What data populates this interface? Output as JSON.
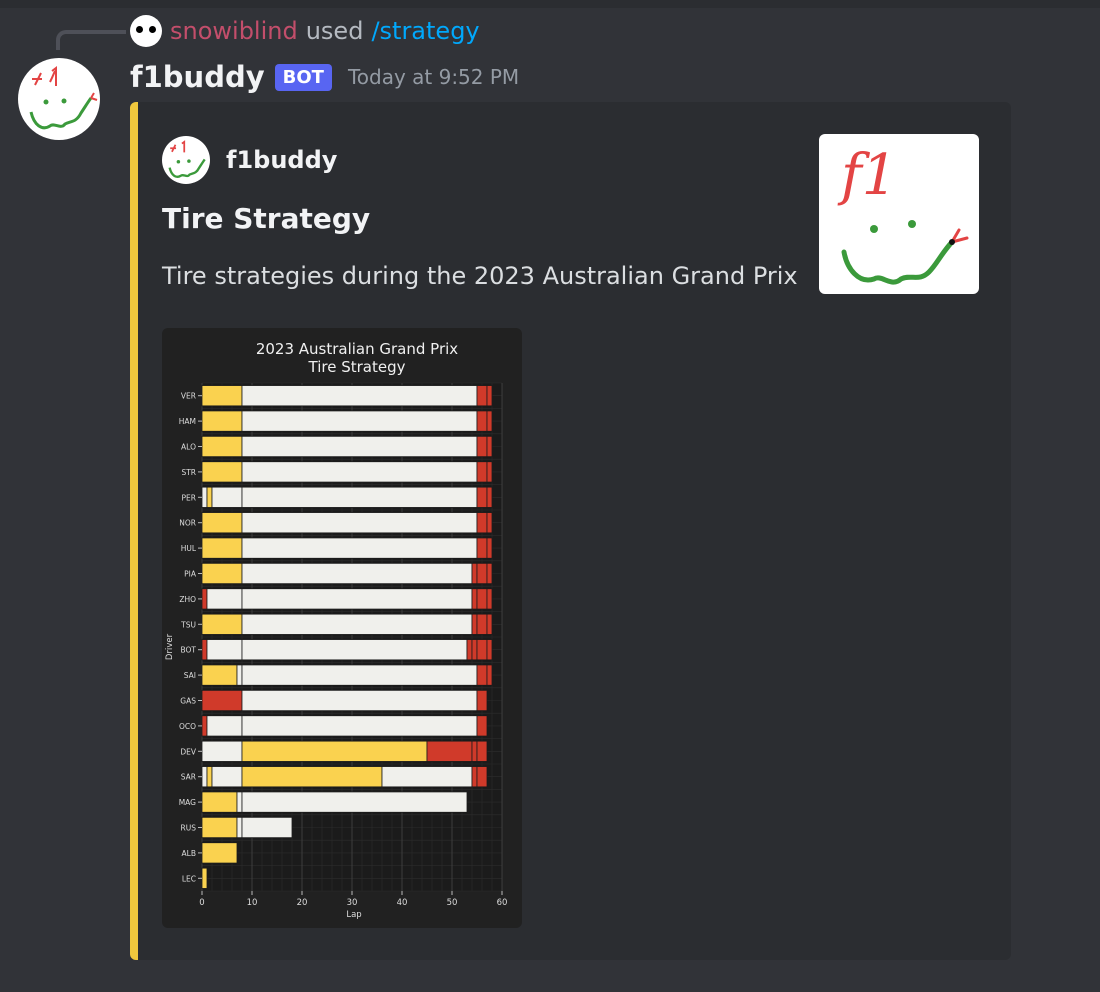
{
  "reply": {
    "user": "snowiblind",
    "used": "used",
    "command": "/strategy"
  },
  "message": {
    "author": "f1buddy",
    "tag": "BOT",
    "timestamp": "Today at 9:52 PM"
  },
  "embed": {
    "author_name": "f1buddy",
    "title": "Tire Strategy",
    "description": "Tire strategies during the 2023 Australian Grand Prix",
    "accent_color": "#f0c83d",
    "thumbnail_text": "f1"
  },
  "chart_data": {
    "type": "bar",
    "orientation": "horizontal-stacked",
    "title": "2023 Australian Grand Prix",
    "subtitle": "Tire Strategy",
    "xlabel": "Lap",
    "ylabel": "Driver",
    "xlim": [
      0,
      60
    ],
    "xticks": [
      0,
      10,
      20,
      30,
      40,
      50,
      60
    ],
    "grid": true,
    "colors": {
      "MEDIUM": "#fad24f",
      "HARD": "#f0f0ec",
      "SOFT": "#d03a2a"
    },
    "drivers": [
      {
        "driver": "VER",
        "stints": [
          [
            "MEDIUM",
            8
          ],
          [
            "HARD",
            47
          ],
          [
            "SOFT",
            2
          ],
          [
            "SOFT",
            1
          ]
        ]
      },
      {
        "driver": "HAM",
        "stints": [
          [
            "MEDIUM",
            8
          ],
          [
            "HARD",
            47
          ],
          [
            "SOFT",
            2
          ],
          [
            "SOFT",
            1
          ]
        ]
      },
      {
        "driver": "ALO",
        "stints": [
          [
            "MEDIUM",
            8
          ],
          [
            "HARD",
            47
          ],
          [
            "SOFT",
            2
          ],
          [
            "SOFT",
            1
          ]
        ]
      },
      {
        "driver": "STR",
        "stints": [
          [
            "MEDIUM",
            8
          ],
          [
            "HARD",
            47
          ],
          [
            "SOFT",
            2
          ],
          [
            "SOFT",
            1
          ]
        ]
      },
      {
        "driver": "PER",
        "stints": [
          [
            "HARD",
            1
          ],
          [
            "MEDIUM",
            1
          ],
          [
            "HARD",
            6
          ],
          [
            "HARD",
            47
          ],
          [
            "SOFT",
            2
          ],
          [
            "SOFT",
            1
          ]
        ]
      },
      {
        "driver": "NOR",
        "stints": [
          [
            "MEDIUM",
            8
          ],
          [
            "HARD",
            47
          ],
          [
            "SOFT",
            2
          ],
          [
            "SOFT",
            1
          ]
        ]
      },
      {
        "driver": "HUL",
        "stints": [
          [
            "MEDIUM",
            8
          ],
          [
            "HARD",
            47
          ],
          [
            "SOFT",
            2
          ],
          [
            "SOFT",
            1
          ]
        ]
      },
      {
        "driver": "PIA",
        "stints": [
          [
            "MEDIUM",
            8
          ],
          [
            "HARD",
            46
          ],
          [
            "SOFT",
            1
          ],
          [
            "SOFT",
            2
          ],
          [
            "SOFT",
            1
          ]
        ]
      },
      {
        "driver": "ZHO",
        "stints": [
          [
            "SOFT",
            1
          ],
          [
            "HARD",
            7
          ],
          [
            "HARD",
            46
          ],
          [
            "SOFT",
            1
          ],
          [
            "SOFT",
            2
          ],
          [
            "SOFT",
            1
          ]
        ]
      },
      {
        "driver": "TSU",
        "stints": [
          [
            "MEDIUM",
            8
          ],
          [
            "HARD",
            46
          ],
          [
            "SOFT",
            1
          ],
          [
            "SOFT",
            2
          ],
          [
            "SOFT",
            1
          ]
        ]
      },
      {
        "driver": "BOT",
        "stints": [
          [
            "SOFT",
            1
          ],
          [
            "HARD",
            7
          ],
          [
            "HARD",
            45
          ],
          [
            "SOFT",
            1
          ],
          [
            "SOFT",
            1
          ],
          [
            "SOFT",
            2
          ],
          [
            "SOFT",
            1
          ]
        ]
      },
      {
        "driver": "SAI",
        "stints": [
          [
            "MEDIUM",
            7
          ],
          [
            "HARD",
            1
          ],
          [
            "HARD",
            47
          ],
          [
            "SOFT",
            2
          ],
          [
            "SOFT",
            1
          ]
        ]
      },
      {
        "driver": "GAS",
        "stints": [
          [
            "SOFT",
            8
          ],
          [
            "HARD",
            47
          ],
          [
            "SOFT",
            2
          ]
        ]
      },
      {
        "driver": "OCO",
        "stints": [
          [
            "SOFT",
            1
          ],
          [
            "HARD",
            7
          ],
          [
            "HARD",
            47
          ],
          [
            "SOFT",
            2
          ]
        ]
      },
      {
        "driver": "DEV",
        "stints": [
          [
            "HARD",
            8
          ],
          [
            "MEDIUM",
            37
          ],
          [
            "SOFT",
            9
          ],
          [
            "SOFT",
            1
          ],
          [
            "SOFT",
            2
          ]
        ]
      },
      {
        "driver": "SAR",
        "stints": [
          [
            "HARD",
            1
          ],
          [
            "MEDIUM",
            1
          ],
          [
            "HARD",
            6
          ],
          [
            "MEDIUM",
            28
          ],
          [
            "HARD",
            18
          ],
          [
            "SOFT",
            1
          ],
          [
            "SOFT",
            2
          ]
        ]
      },
      {
        "driver": "MAG",
        "stints": [
          [
            "MEDIUM",
            7
          ],
          [
            "HARD",
            1
          ],
          [
            "HARD",
            45
          ]
        ]
      },
      {
        "driver": "RUS",
        "stints": [
          [
            "MEDIUM",
            7
          ],
          [
            "HARD",
            1
          ],
          [
            "HARD",
            10
          ]
        ]
      },
      {
        "driver": "ALB",
        "stints": [
          [
            "MEDIUM",
            7
          ]
        ]
      },
      {
        "driver": "LEC",
        "stints": [
          [
            "MEDIUM",
            1
          ]
        ]
      }
    ]
  }
}
